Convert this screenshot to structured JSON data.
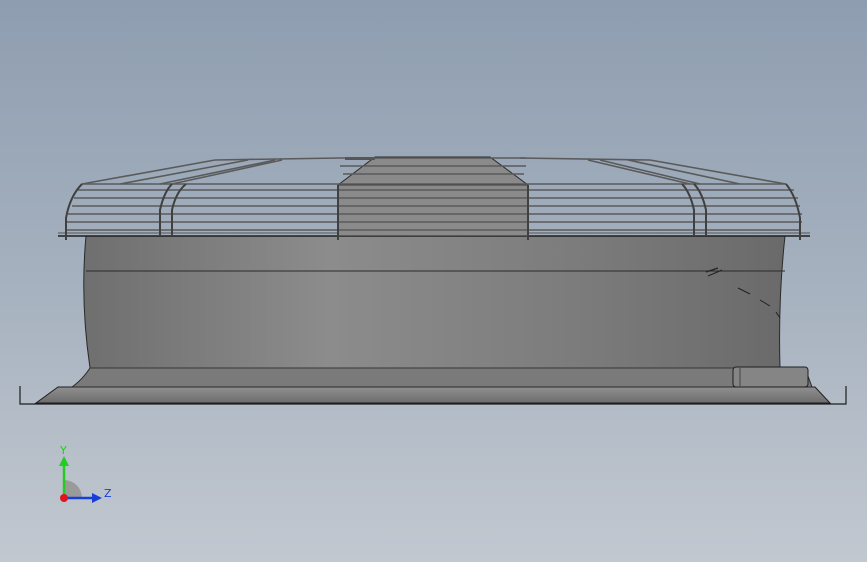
{
  "viewport": {
    "background_top": "#8e9db0",
    "background_bottom": "#c2c8d0"
  },
  "model": {
    "body_color": "#7d7d7d",
    "edge_color": "#1e1e1e",
    "guard_color": "#6a6a6a"
  },
  "triad": {
    "y_label": "Y",
    "z_label": "Z",
    "y_color": "#22cc22",
    "z_color": "#1a3fd6",
    "x_color": "#e0141e"
  }
}
